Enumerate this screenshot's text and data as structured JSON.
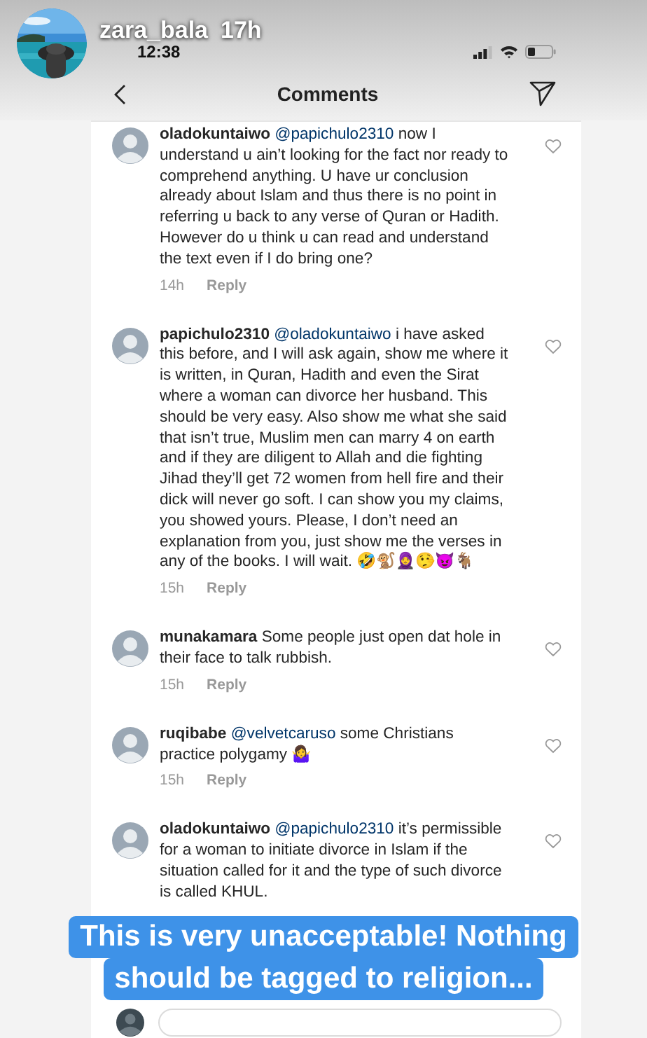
{
  "story": {
    "username": "zara_bala",
    "time": "17h"
  },
  "status_bar": {
    "time": "12:38"
  },
  "header": {
    "title": "Comments"
  },
  "comments": [
    {
      "username": "oladokuntaiwo",
      "mention": "@papichulo2310",
      "text": "now I understand u ain’t looking for the fact nor ready to comprehend anything. U have ur conclusion already about Islam and thus there is no point in referring u back to any verse of Quran or Hadith.\nHowever do u think u can read and understand the text even if I do bring one?",
      "time": "14h",
      "reply": "Reply",
      "liked": false
    },
    {
      "username": "papichulo2310",
      "mention": "@oladokuntaiwo",
      "text": "i have asked this before, and I will ask again, show me where it is written, in Quran, Hadith and even the Sirat where a woman can divorce her husband. This should be very easy. Also show me what she said that isn’t true, Muslim men can marry 4 on earth and if they are diligent to Allah and die fighting Jihad they’ll get 72 women from hell fire and their dick will never go soft. I can show you my claims, you showed yours. Please, I don’t need an explanation from you, just show me the verses in any of the books. I will wait. 🤣🐒🧕🤥😈🐐",
      "time": "15h",
      "reply": "Reply",
      "liked": false
    },
    {
      "username": "munakamara",
      "text": "Some people just open dat hole in their face to talk rubbish.",
      "time": "15h",
      "reply": "Reply",
      "liked": false
    },
    {
      "username": "ruqibabe",
      "mention": "@velvetcaruso",
      "text": "some Christians practice polygamy 🤷‍♀️",
      "time": "15h",
      "reply": "Reply",
      "liked": false
    },
    {
      "username": "oladokuntaiwo",
      "mention": "@papichulo2310",
      "text": "it’s permissible for a woman to initiate divorce in Islam if the situation called for it and the type of such divorce is called KHUL.",
      "liked": false
    }
  ],
  "caption": [
    "This is very unacceptable! Nothing",
    "should be tagged to religion..."
  ]
}
